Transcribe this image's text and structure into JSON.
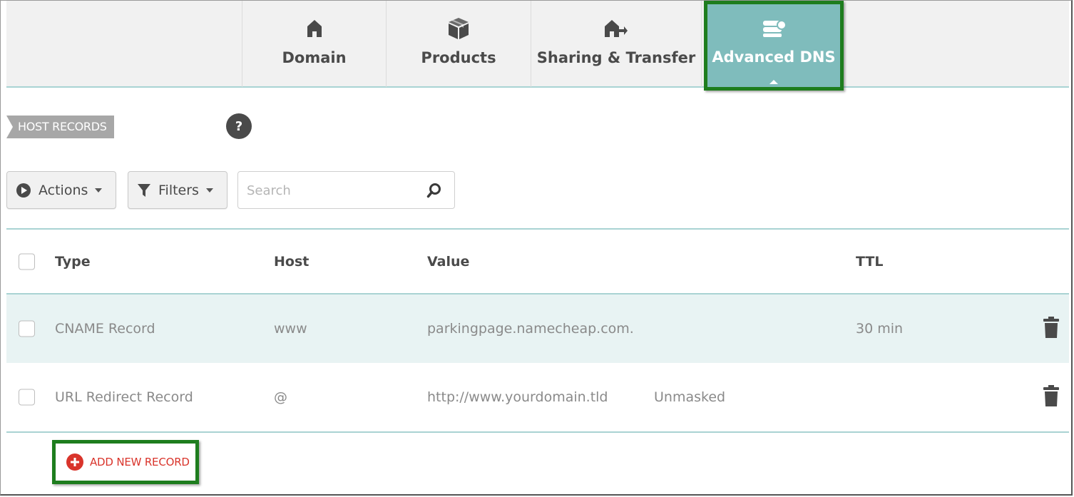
{
  "tabs": [
    {
      "label": "Domain",
      "icon": "house-icon"
    },
    {
      "label": "Products",
      "icon": "box-icon"
    },
    {
      "label": "Sharing & Transfer",
      "icon": "house-arrow-icon"
    },
    {
      "label": "Advanced DNS",
      "icon": "dns-server-icon",
      "active": true
    }
  ],
  "section": {
    "title": "HOST RECORDS",
    "help": "?"
  },
  "toolbar": {
    "actions_label": "Actions",
    "filters_label": "Filters",
    "search_placeholder": "Search"
  },
  "table": {
    "headers": {
      "type": "Type",
      "host": "Host",
      "value": "Value",
      "ttl": "TTL"
    },
    "rows": [
      {
        "type": "CNAME Record",
        "host": "www",
        "value": "parkingpage.namecheap.com.",
        "extra": "",
        "ttl": "30 min"
      },
      {
        "type": "URL Redirect Record",
        "host": "@",
        "value": "http://www.yourdomain.tld",
        "extra": "Unmasked",
        "ttl": ""
      }
    ]
  },
  "add_record": {
    "label": "ADD NEW RECORD"
  },
  "colors": {
    "active_tab": "#7fbcbc",
    "highlight_border": "#1e7d1e",
    "divider": "#a9d3d3",
    "add_red": "#d9342b",
    "row_highlight": "#e8f3f3"
  }
}
